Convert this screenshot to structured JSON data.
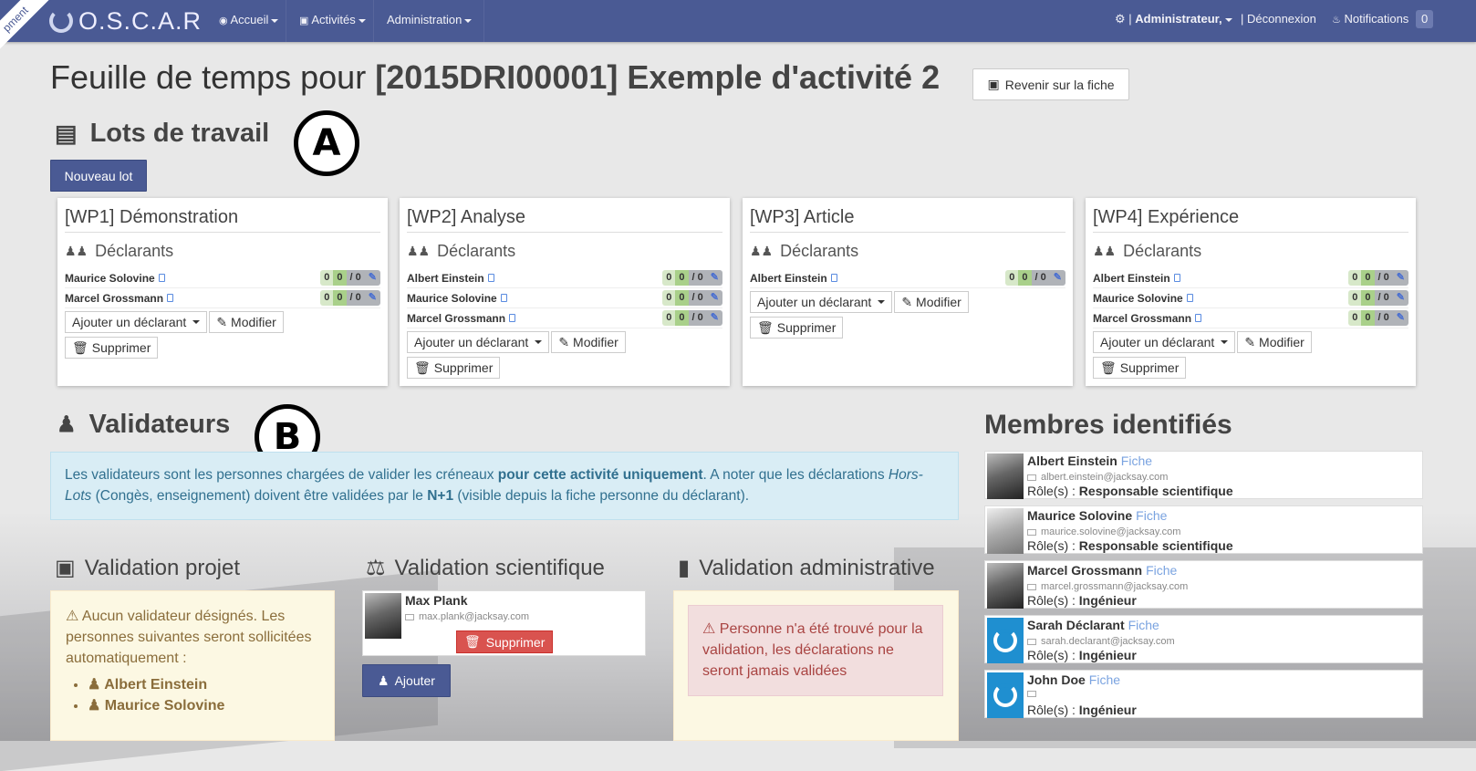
{
  "ribbon": "pment",
  "nav": {
    "brand": "O.S.C.A.R",
    "items": [
      {
        "label": "Accueil"
      },
      {
        "label": "Activités"
      },
      {
        "label": "Administration"
      }
    ],
    "user": "Administrateur,",
    "logout": "Déconnexion",
    "notifications_label": "Notifications",
    "notifications_count": "0"
  },
  "page": {
    "title_prefix": "Feuille de temps pour",
    "title_bold": "[2015DRI00001] Exemple d'activité 2",
    "back_button": "Revenir sur la fiche"
  },
  "lots": {
    "title": "Lots de travail",
    "marker": "A",
    "new_button": "Nouveau lot",
    "declarants_label": "Déclarants",
    "add_declarant": "Ajouter un déclarant",
    "modify": "Modifier",
    "delete": "Supprimer",
    "cards": [
      {
        "title": "[WP1] Démonstration",
        "declarants": [
          {
            "name": "Maurice Solovine",
            "c1": "0",
            "c2": "0",
            "c3": "/ 0"
          },
          {
            "name": "Marcel Grossmann",
            "c1": "0",
            "c2": "0",
            "c3": "/ 0"
          }
        ]
      },
      {
        "title": "[WP2] Analyse",
        "declarants": [
          {
            "name": "Albert Einstein",
            "c1": "0",
            "c2": "0",
            "c3": "/ 0"
          },
          {
            "name": "Maurice Solovine",
            "c1": "0",
            "c2": "0",
            "c3": "/ 0"
          },
          {
            "name": "Marcel Grossmann",
            "c1": "0",
            "c2": "0",
            "c3": "/ 0"
          }
        ]
      },
      {
        "title": "[WP3] Article",
        "declarants": [
          {
            "name": "Albert Einstein",
            "c1": "0",
            "c2": "0",
            "c3": "/ 0"
          }
        ]
      },
      {
        "title": "[WP4] Expérience",
        "declarants": [
          {
            "name": "Albert Einstein",
            "c1": "0",
            "c2": "0",
            "c3": "/ 0"
          },
          {
            "name": "Maurice Solovine",
            "c1": "0",
            "c2": "0",
            "c3": "/ 0"
          },
          {
            "name": "Marcel Grossmann",
            "c1": "0",
            "c2": "0",
            "c3": "/ 0"
          }
        ]
      }
    ]
  },
  "validateurs": {
    "title": "Validateurs",
    "marker": "B",
    "info_1": "Les validateurs sont les personnes chargées de valider les créneaux ",
    "info_bold_1": "pour cette activité uniquement",
    "info_2": ". A noter que les déclarations ",
    "info_italic": "Hors-Lots",
    "info_3": " (Congès, enseignement) doivent être validées par le ",
    "info_bold_2": "N+1",
    "info_4": " (visible depuis la fiche personne du déclarant).",
    "projet": {
      "title": "Validation projet",
      "warning": "Aucun validateur désignés. Les personnes suivantes seront sollicitées automatiquement :",
      "people": [
        "Albert Einstein",
        "Maurice Solovine"
      ]
    },
    "scientifique": {
      "title": "Validation scientifique",
      "person": {
        "name": "Max Plank",
        "email": "max.plank@jacksay.com"
      },
      "delete": "Supprimer",
      "add": "Ajouter"
    },
    "administrative": {
      "title": "Validation administrative",
      "error": "Personne n'a été trouvé pour la validation, les déclarations ne seront jamais validées"
    }
  },
  "members": {
    "title": "Membres identifiés",
    "fiche": "Fiche",
    "roles_label": "Rôle(s) :",
    "list": [
      {
        "name": "Albert Einstein",
        "email": "albert.einstein@jacksay.com",
        "role": "Responsable scientifique"
      },
      {
        "name": "Maurice Solovine",
        "email": "maurice.solovine@jacksay.com",
        "role": "Responsable scientifique"
      },
      {
        "name": "Marcel Grossmann",
        "email": "marcel.grossmann@jacksay.com",
        "role": "Ingénieur"
      },
      {
        "name": "Sarah Déclarant",
        "email": "sarah.declarant@jacksay.com",
        "role": "Ingénieur"
      },
      {
        "name": "John Doe",
        "email": "",
        "role": "Ingénieur"
      }
    ]
  }
}
